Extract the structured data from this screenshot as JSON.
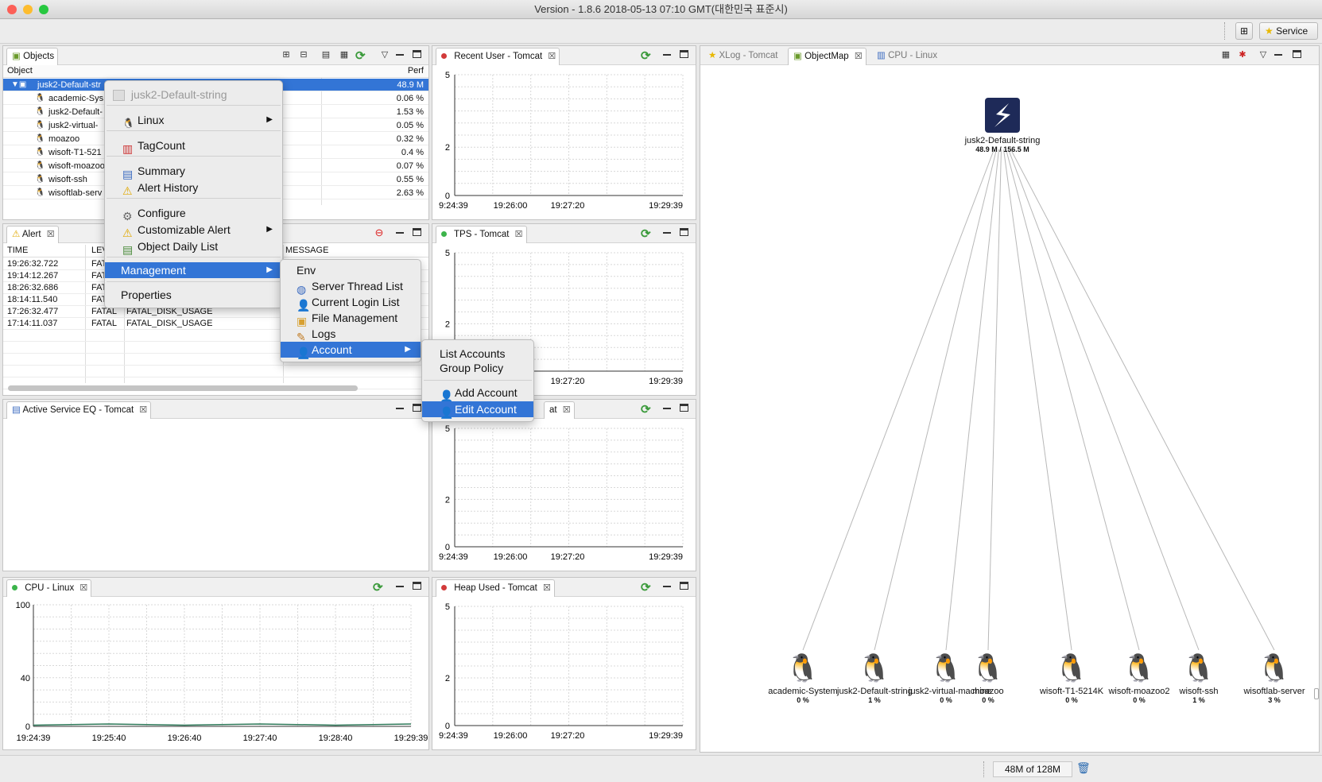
{
  "window": {
    "title": "Version - 1.8.6 2018-05-13 07:10 GMT(대한민국 표준시)"
  },
  "toolbar": {
    "service_label": "Service"
  },
  "objects_panel": {
    "tab_label": "Objects",
    "col_object": "Object",
    "col_perf": "Perf",
    "rows": [
      {
        "name": "jusk2-Default-str",
        "perf": "48.9 M"
      },
      {
        "name": "academic-Sys",
        "perf": "0.06 %"
      },
      {
        "name": "jusk2-Default-",
        "perf": "1.53 %"
      },
      {
        "name": "jusk2-virtual-",
        "perf": "0.05 %"
      },
      {
        "name": "moazoo",
        "perf": "0.32 %"
      },
      {
        "name": "wisoft-T1-521",
        "perf": "0.4 %"
      },
      {
        "name": "wisoft-moazoo",
        "perf": "0.07 %"
      },
      {
        "name": "wisoft-ssh",
        "perf": "0.55 %"
      },
      {
        "name": "wisoftlab-serv",
        "perf": "2.63 %"
      }
    ]
  },
  "alert_panel": {
    "tab_label": "Alert",
    "col_time": "TIME",
    "col_level": "LEV",
    "col_message": "MESSAGE",
    "rows": [
      {
        "time": "19:26:32.722",
        "level": "FAT",
        "title": "",
        "message": ""
      },
      {
        "time": "19:14:12.267",
        "level": "FAT",
        "title": "",
        "message": ""
      },
      {
        "time": "18:26:32.686",
        "level": "FAT",
        "title": "",
        "message": ""
      },
      {
        "time": "18:14:11.540",
        "level": "FAT",
        "title": "",
        "message": ""
      },
      {
        "time": "17:26:32.477",
        "level": "FATAL",
        "title": "FATAL_DISK_USAGE",
        "message": ""
      },
      {
        "time": "17:14:11.037",
        "level": "FATAL",
        "title": "FATAL_DISK_USAGE",
        "message": ""
      }
    ]
  },
  "active_service_panel": {
    "tab_label": "Active Service EQ - Tomcat"
  },
  "recent_user_panel": {
    "tab_label": "Recent User - Tomcat"
  },
  "tps_panel": {
    "tab_label": "TPS - Tomcat"
  },
  "third_mid_panel": {
    "tab_label": "at"
  },
  "heap_panel": {
    "tab_label": "Heap Used - Tomcat"
  },
  "cpu_panel": {
    "tab_label": "CPU - Linux"
  },
  "right_tabs": {
    "xlog": "XLog - Tomcat",
    "objectmap": "ObjectMap",
    "cpu": "CPU - Linux"
  },
  "small_charts": {
    "y_ticks": [
      "5",
      "2",
      "0"
    ],
    "x_ticks": [
      "9:24:39",
      "19:26:00",
      "19:27:20",
      "19:29:39"
    ]
  },
  "cpu_chart": {
    "y_ticks": [
      "100",
      "40",
      "0"
    ],
    "x_ticks": [
      "19:24:39",
      "19:25:40",
      "19:26:40",
      "19:27:40",
      "19:28:40",
      "19:29:39"
    ]
  },
  "chart_data": [
    {
      "type": "line",
      "title": "CPU - Linux",
      "ylim": [
        0,
        100
      ],
      "x": [
        "19:24:39",
        "19:25:40",
        "19:26:40",
        "19:27:40",
        "19:28:40",
        "19:29:39"
      ],
      "series": [
        {
          "values": [
            1,
            2,
            1,
            2,
            1,
            2
          ]
        }
      ]
    }
  ],
  "object_map": {
    "root": {
      "name": "jusk2-Default-string",
      "value": "48.9 M / 156.5 M"
    },
    "children": [
      {
        "name": "academic-System",
        "pct": "0 %"
      },
      {
        "name": "jusk2-Default-string",
        "pct": "1 %"
      },
      {
        "name": "jusk2-virtual-machine",
        "pct": "0 %"
      },
      {
        "name": "moazoo",
        "pct": "0 %"
      },
      {
        "name": "wisoft-T1-5214K",
        "pct": "0 %"
      },
      {
        "name": "wisoft-moazoo2",
        "pct": "0 %"
      },
      {
        "name": "wisoft-ssh",
        "pct": "1 %"
      },
      {
        "name": "wisoftlab-server",
        "pct": "3 %"
      }
    ]
  },
  "context_menu": {
    "header": "jusk2-Default-string",
    "linux": "Linux",
    "tagcount": "TagCount",
    "summary": "Summary",
    "alert_history": "Alert History",
    "configure": "Configure",
    "customizable_alert": "Customizable Alert",
    "object_daily_list": "Object Daily List",
    "management": "Management",
    "properties": "Properties"
  },
  "management_menu": {
    "env": "Env",
    "server_thread_list": "Server Thread List",
    "current_login_list": "Current Login List",
    "file_management": "File Management",
    "logs": "Logs",
    "account": "Account"
  },
  "account_menu": {
    "list_accounts": "List Accounts",
    "group_policy": "Group Policy",
    "add_account": "Add Account",
    "edit_account": "Edit Account"
  },
  "status": {
    "memory": "48M of 128M"
  }
}
